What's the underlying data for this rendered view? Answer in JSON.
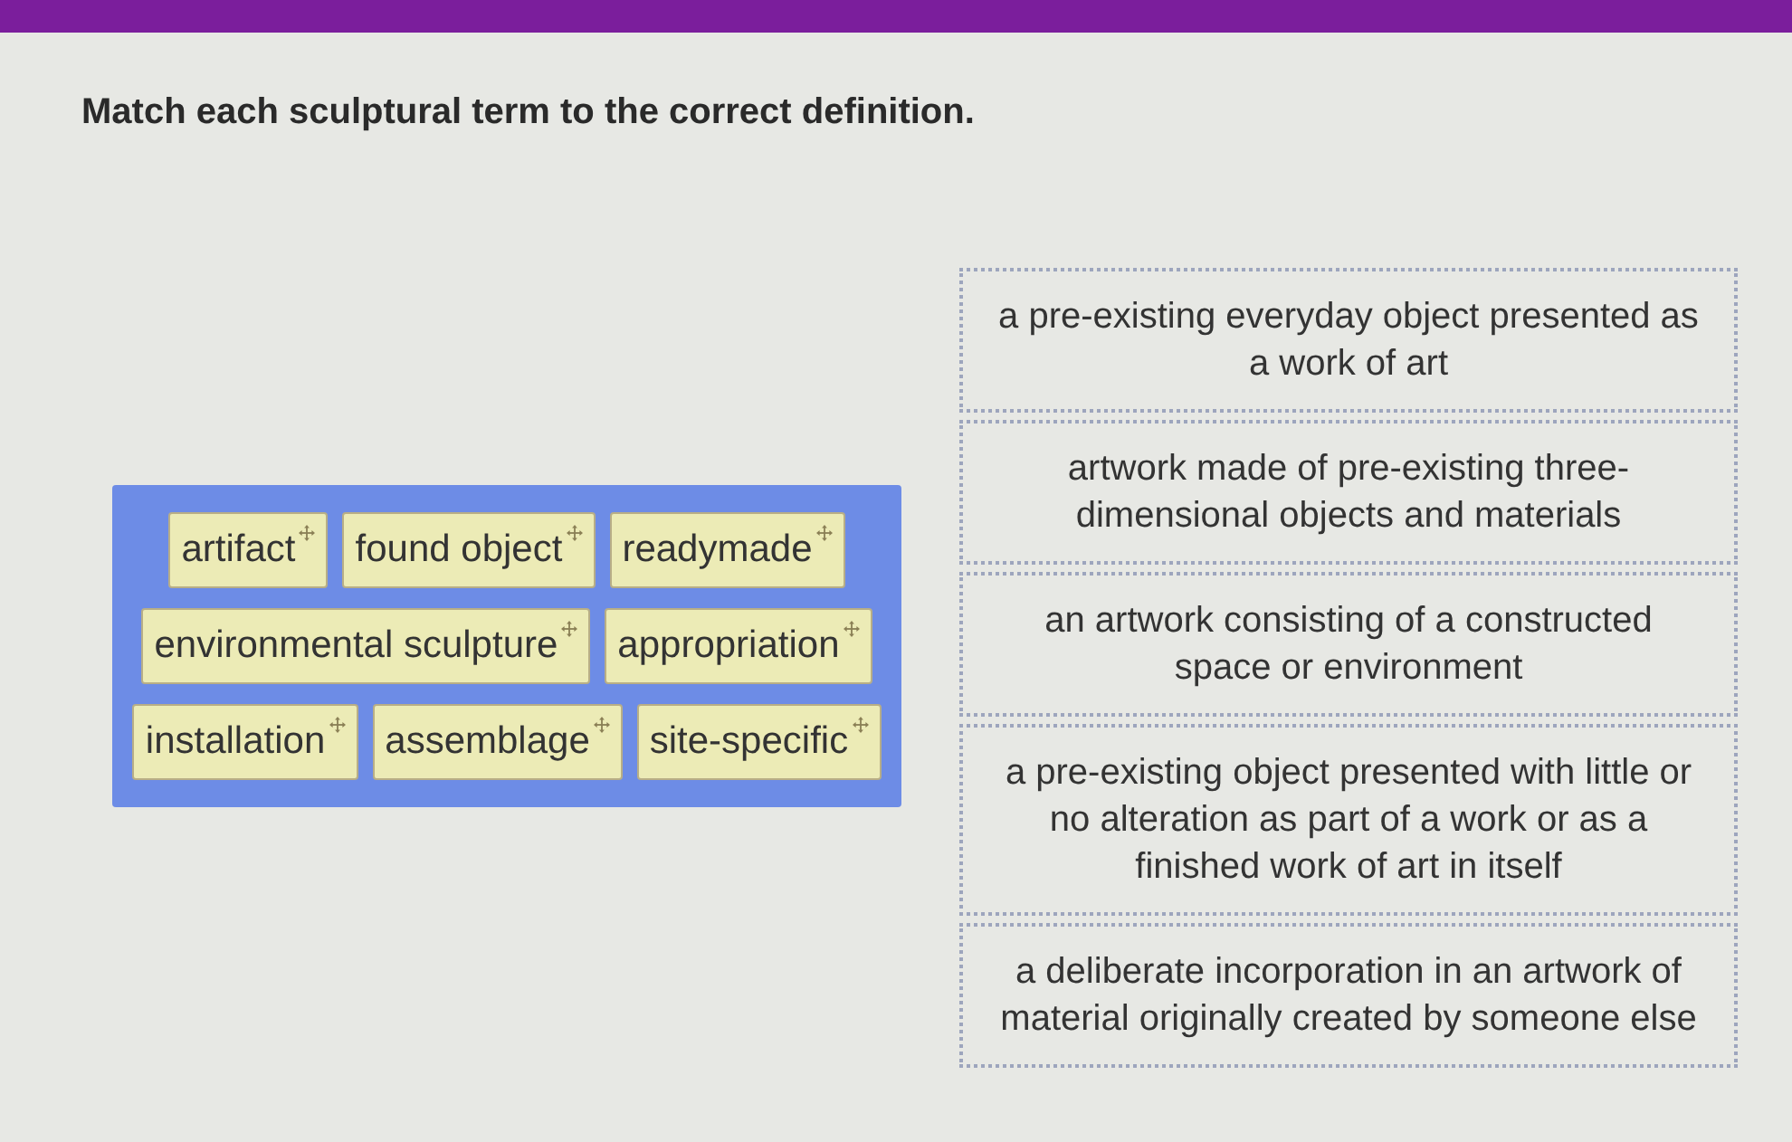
{
  "instruction": "Match each sculptural term to the correct definition.",
  "term_bank": {
    "terms": [
      "artifact",
      "found object",
      "readymade",
      "environmental sculpture",
      "appropriation",
      "installation",
      "assemblage",
      "site-specific"
    ]
  },
  "definitions": [
    "a pre-existing everyday object presented as a work of art",
    "artwork made of pre-existing three-dimensional objects and materials",
    "an artwork consisting of a constructed space or environment",
    "a pre-existing object presented with little or no alteration as part of a work or as a finished work of art in itself",
    "a deliberate incorporation in an artwork of material originally created by someone else"
  ]
}
